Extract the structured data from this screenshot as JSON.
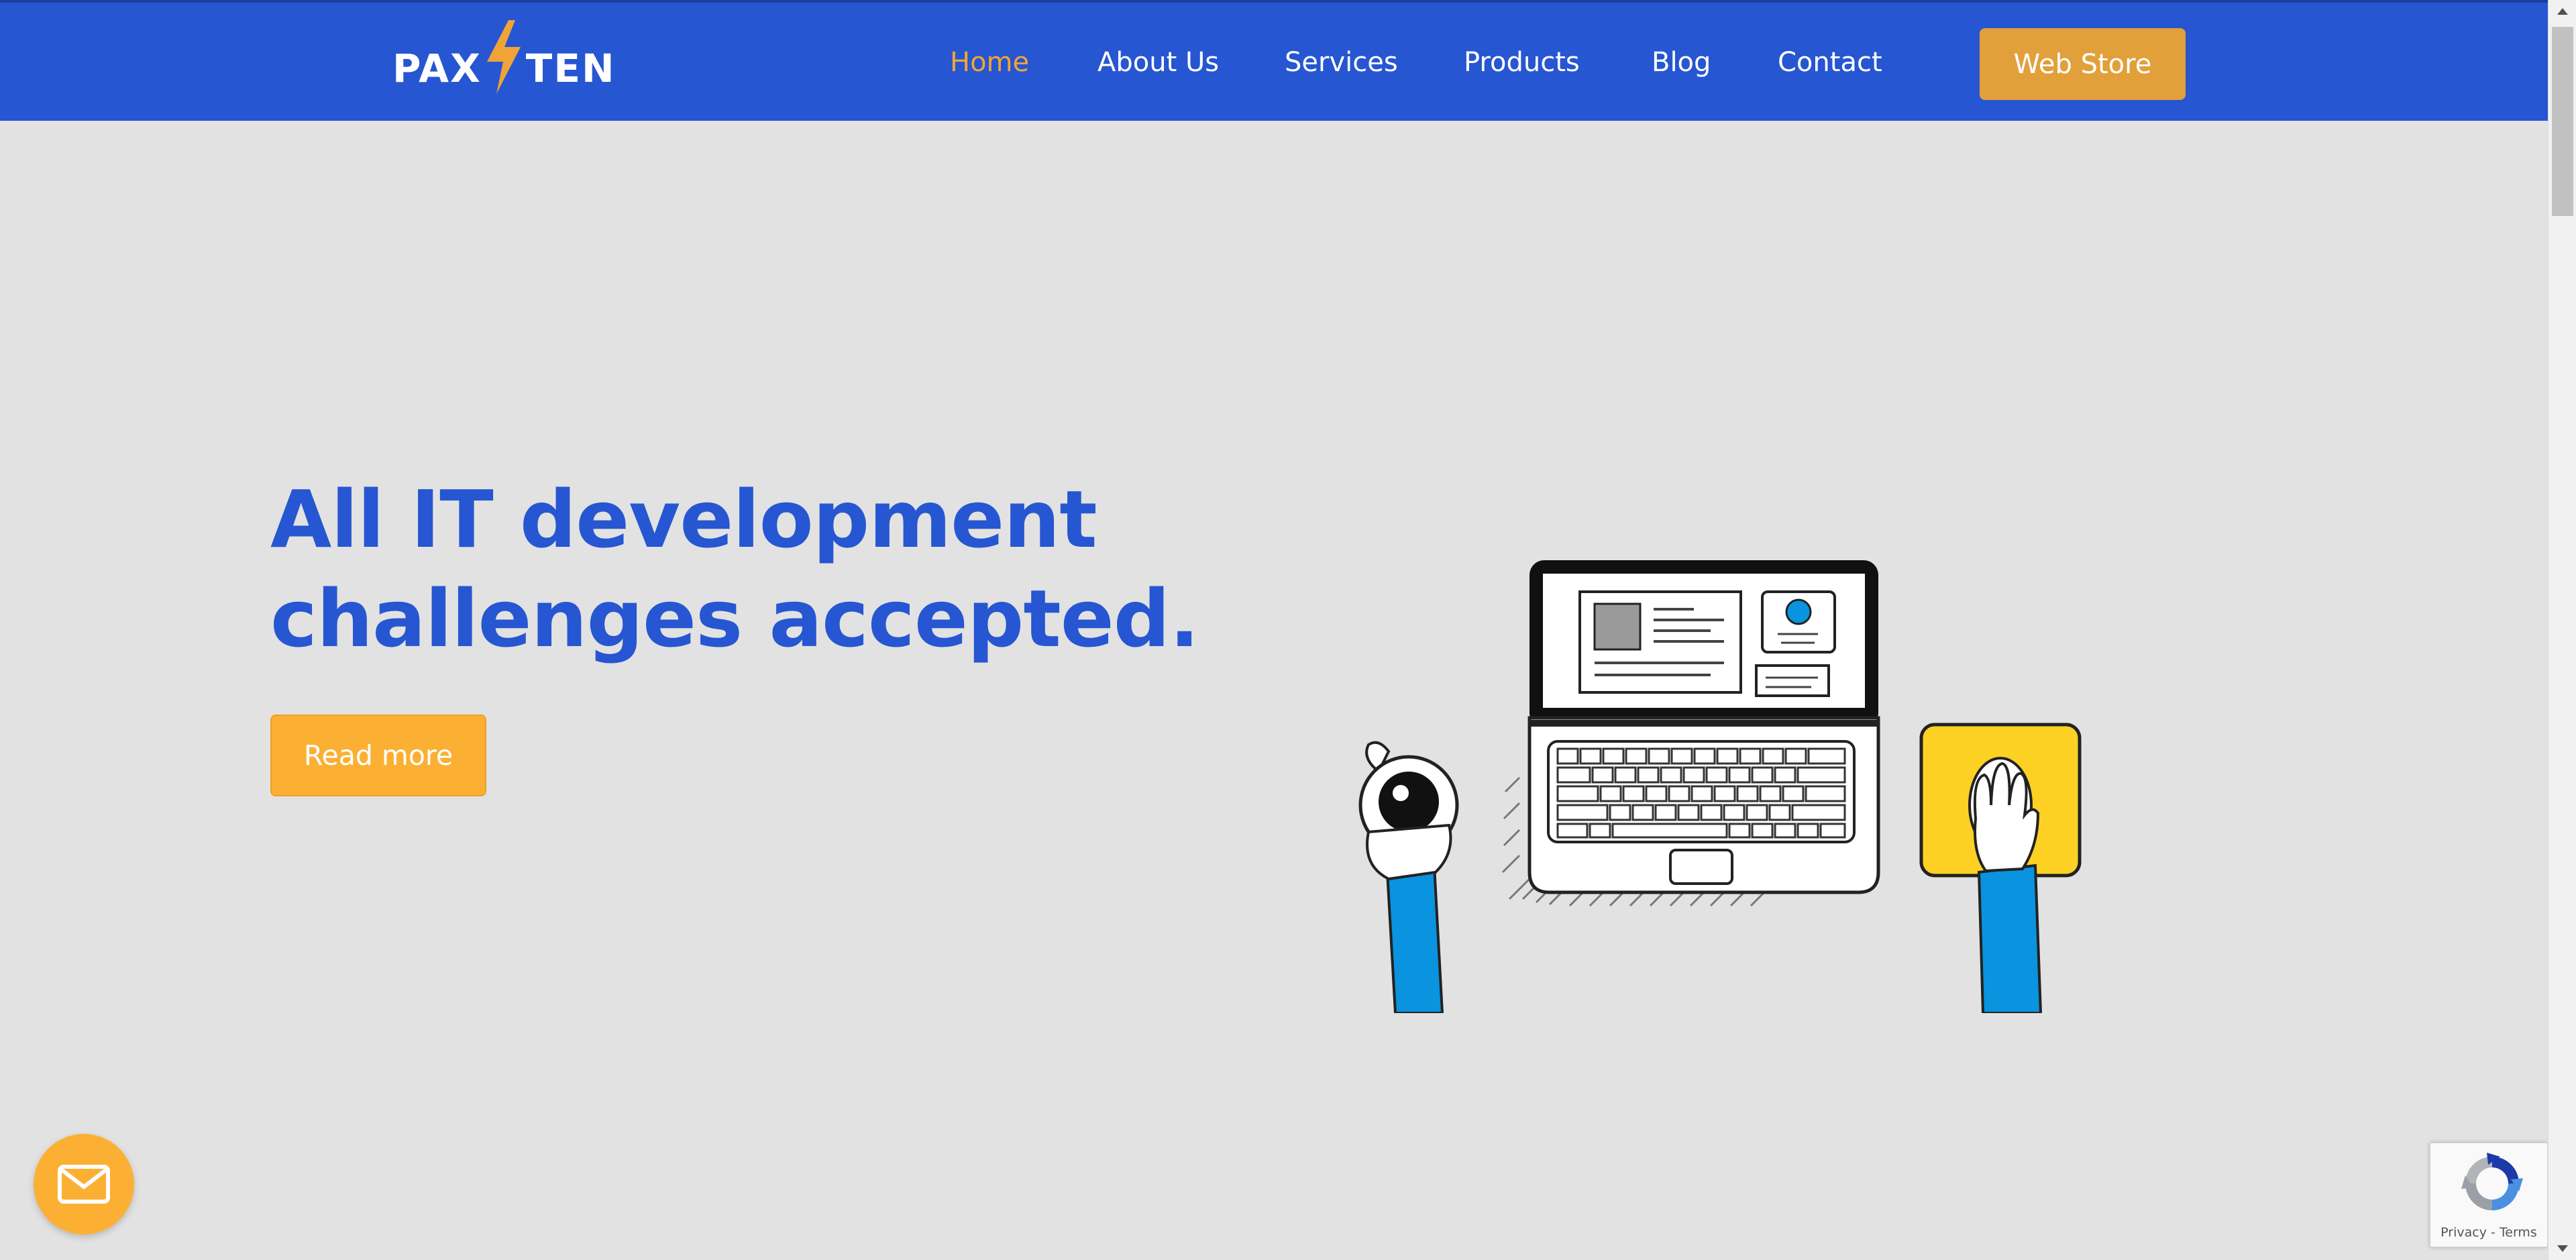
{
  "header": {
    "logo_left": "PAX",
    "logo_right": "TEN",
    "nav_items": [
      {
        "label": "Home",
        "active": true
      },
      {
        "label": "About Us",
        "active": false
      },
      {
        "label": "Services",
        "active": false
      },
      {
        "label": "Products",
        "active": false
      },
      {
        "label": "Blog",
        "active": false
      },
      {
        "label": "Contact",
        "active": false
      }
    ],
    "cta_label": "Web Store"
  },
  "hero": {
    "title_line1": "All IT development",
    "title_line2": "challenges accepted.",
    "button_label": "Read more",
    "illustration": "laptop-desk-illustration-icon"
  },
  "floating": {
    "mail_icon": "mail-icon"
  },
  "recaptcha": {
    "links": "Privacy - Terms"
  },
  "colors": {
    "nav_bg": "#2656d1",
    "accent_orange": "#f0a437",
    "cta_bg": "#e2a03a",
    "button_bg": "#fbb034",
    "page_bg": "#e2e2e2",
    "title_blue": "#2656d1",
    "illustration_blue": "#0a93df",
    "illustration_yellow": "#fdd123"
  }
}
